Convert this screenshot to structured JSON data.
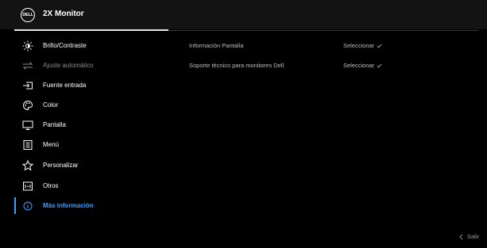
{
  "header": {
    "logo_text": "DELL",
    "title": "2X Monitor"
  },
  "menu": [
    {
      "label": "Brillo/Contraste",
      "icon": "brightness-icon",
      "state": "normal"
    },
    {
      "label": "Ajuste automático",
      "icon": "auto-adjust-icon",
      "state": "disabled"
    },
    {
      "label": "Fuente entrada",
      "icon": "input-source-icon",
      "state": "normal"
    },
    {
      "label": "Color",
      "icon": "color-palette-icon",
      "state": "normal"
    },
    {
      "label": "Pantalla",
      "icon": "display-icon",
      "state": "normal"
    },
    {
      "label": "Menú",
      "icon": "menu-icon",
      "state": "normal"
    },
    {
      "label": "Personalizar",
      "icon": "star-icon",
      "state": "normal"
    },
    {
      "label": "Otros",
      "icon": "others-icon",
      "state": "normal"
    },
    {
      "label": "Más información",
      "icon": "info-icon",
      "state": "active"
    }
  ],
  "details": [
    {
      "label": "Información Pantalla",
      "value": "Seleccionar"
    },
    {
      "label": "Soporte técnico para monitores Dell",
      "value": "Seleccionar"
    }
  ],
  "footer": {
    "exit_label": "Salir",
    "exit_icon": "chevron-left-icon"
  },
  "colors": {
    "accent": "#3aa1ff",
    "background": "#000000",
    "header": "#131313"
  }
}
